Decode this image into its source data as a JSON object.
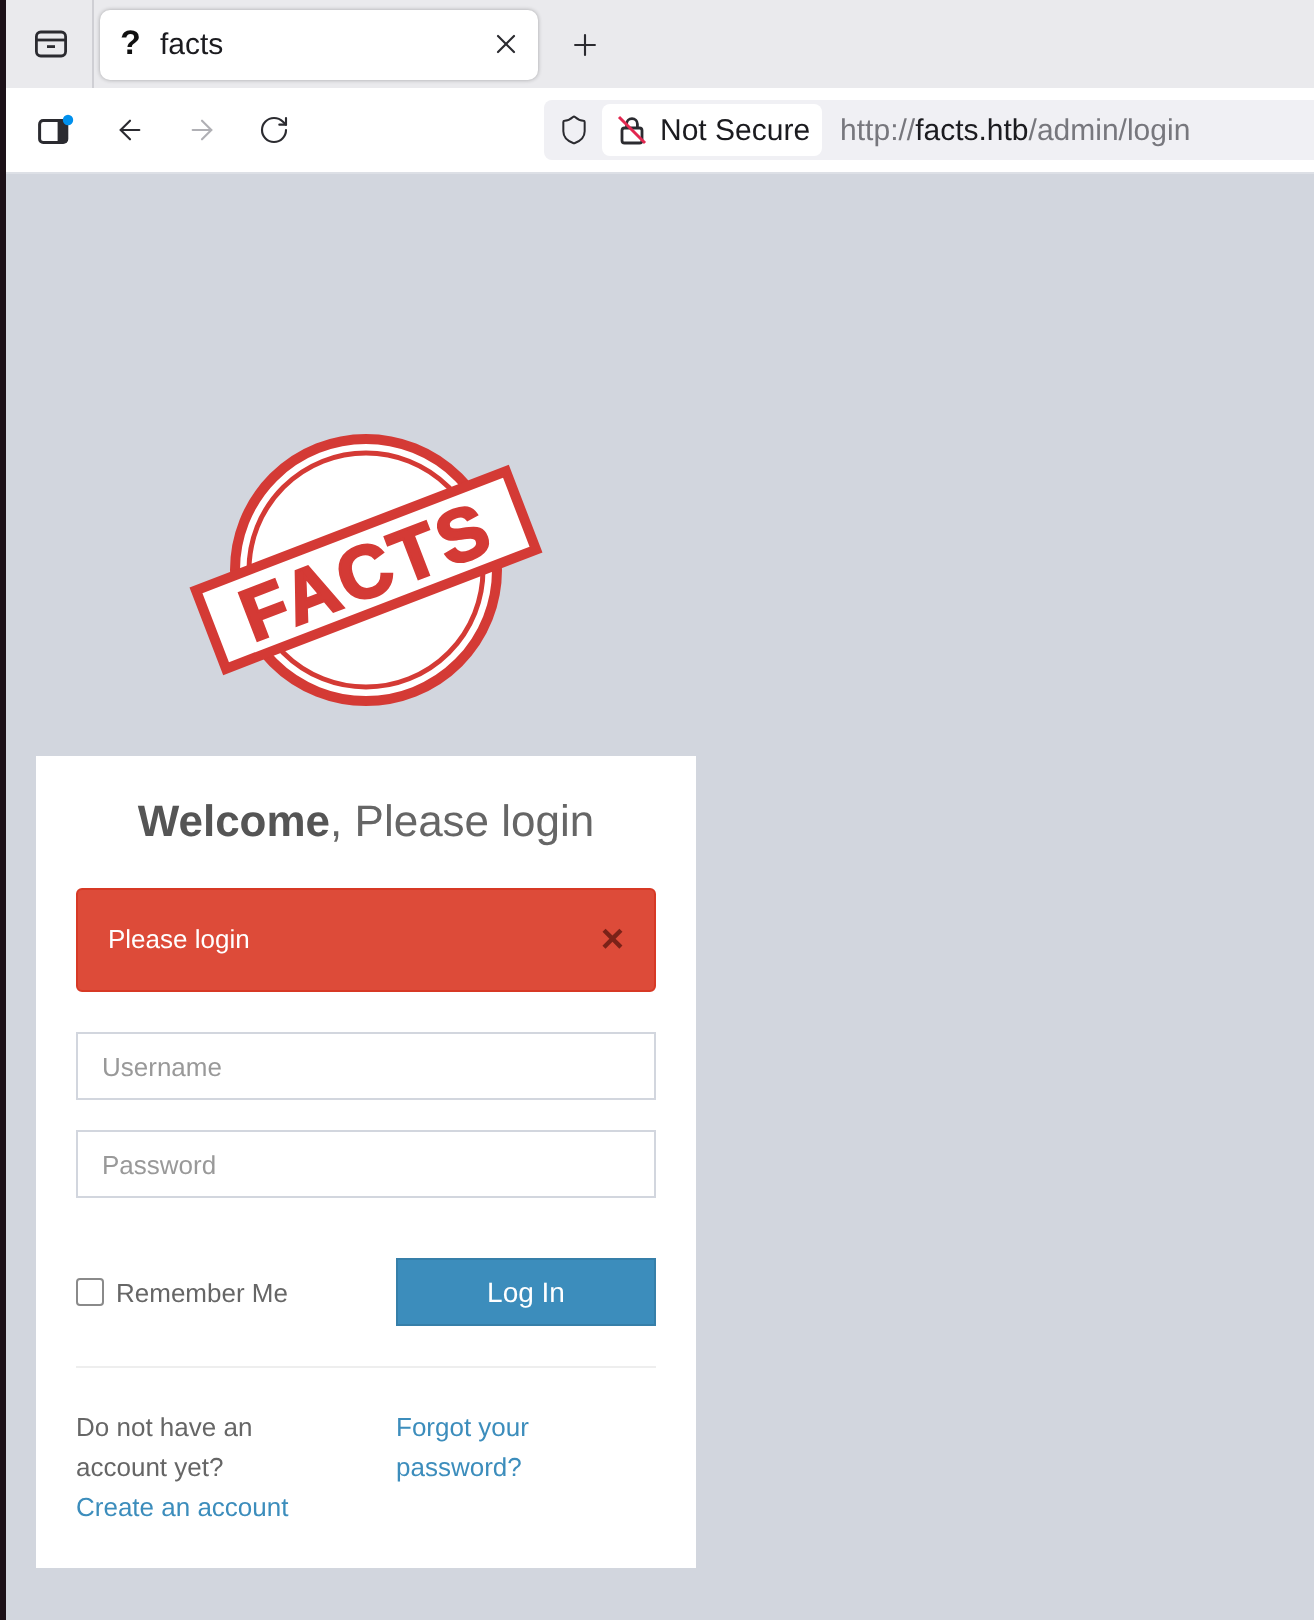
{
  "browser": {
    "tab_strip": {
      "tabs": [
        {
          "icon_glyph": "?",
          "title": "facts",
          "selected": true
        }
      ]
    },
    "toolbar": {
      "sidebar_notification": true,
      "back": {
        "disabled": false
      },
      "forward": {
        "disabled": true
      },
      "address_bar": {
        "security_label": "Not Secure",
        "url_scheme": "http://",
        "url_host": "facts.htb",
        "url_path": "/admin/login"
      }
    }
  },
  "page": {
    "logo": {
      "text": "FACTS"
    },
    "login_box": {
      "title": "**Welcome**, Please login",
      "alert": {
        "message": "Please login",
        "dismiss": "×"
      },
      "fields": [
        {
          "placeholder": "Username"
        },
        {
          "placeholder": "Password"
        }
      ],
      "remember": {
        "label": "Remember Me",
        "checked": false
      },
      "submit": "Log In",
      "register_prompt": "Do not have an account yet?",
      "register_link": "Create an account",
      "forgot_link": "Forgot your password?"
    }
  }
}
